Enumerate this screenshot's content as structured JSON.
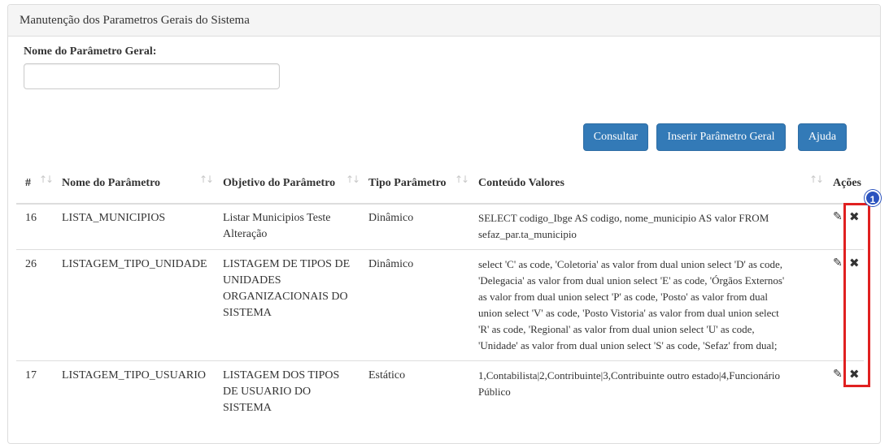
{
  "panel": {
    "title": "Manutenção dos Parametros Gerais do Sistema"
  },
  "form": {
    "name_label": "Nome do Parâmetro Geral:",
    "name_value": "",
    "name_placeholder": ""
  },
  "buttons": {
    "consultar": "Consultar",
    "inserir": "Inserir Parâmetro Geral",
    "ajuda": "Ajuda"
  },
  "table": {
    "headers": {
      "num": "#",
      "nome": "Nome do Parâmetro",
      "objetivo": "Objetivo do Parâmetro",
      "tipo": "Tipo Parâmetro",
      "conteudo": "Conteúdo Valores",
      "acoes": "Ações"
    },
    "rows": [
      {
        "id": "16",
        "nome": "LISTA_MUNICIPIOS",
        "objetivo": [
          "Listar Municipios Teste",
          "Alteração"
        ],
        "tipo": "Dinâmico",
        "conteudo": [
          "SELECT codigo_Ibge AS codigo, nome_municipio AS valor FROM",
          "sefaz_par.ta_municipio"
        ]
      },
      {
        "id": "26",
        "nome": "LISTAGEM_TIPO_UNIDADE",
        "objetivo": [
          "LISTAGEM DE TIPOS DE",
          "UNIDADES",
          "ORGANIZACIONAIS DO",
          "SISTEMA"
        ],
        "tipo": "Dinâmico",
        "conteudo": [
          "select 'C' as code, 'Coletoria' as valor from dual union select 'D' as code,",
          "'Delegacia' as valor from dual union select 'E' as code, 'Órgãos Externos'",
          "as valor from dual union select 'P' as code, 'Posto' as valor from dual",
          "union select 'V' as code, 'Posto Vistoria' as valor from dual union select",
          "'R' as code, 'Regional' as valor from dual union select 'U' as code,",
          "'Unidade' as valor from dual union select 'S' as code, 'Sefaz' from dual;"
        ]
      },
      {
        "id": "17",
        "nome": "LISTAGEM_TIPO_USUARIO",
        "objetivo": [
          "LISTAGEM DOS TIPOS",
          "DE USUARIO DO",
          "SISTEMA"
        ],
        "tipo": "Estático",
        "conteudo": [
          "1,Contabilista|2,Contribuinte|3,Contribuinte outro estado|4,Funcionário",
          "Público"
        ]
      }
    ]
  },
  "icons": {
    "sort": "↑↓",
    "edit": "✎",
    "delete": "✖"
  },
  "annotation": {
    "badge": "1",
    "color": "#e02020",
    "badge_color": "#2a52be"
  },
  "colors": {
    "primary": "#337ab7",
    "heading_bg": "#f5f5f5",
    "border": "#dddddd"
  }
}
